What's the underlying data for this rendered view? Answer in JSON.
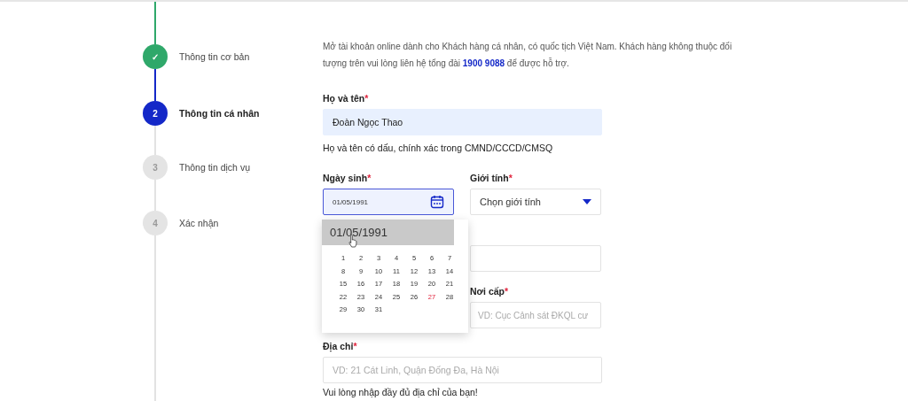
{
  "steps": [
    {
      "marker": "✓",
      "label": "Thông tin cơ bản",
      "kind": "done"
    },
    {
      "marker": "2",
      "label": "Thông tin cá nhân",
      "kind": "current"
    },
    {
      "marker": "3",
      "label": "Thông tin dịch vụ",
      "kind": "pending"
    },
    {
      "marker": "4",
      "label": "Xác nhận",
      "kind": "pending"
    }
  ],
  "intro": "Mở tài khoản online dành cho Khách hàng cá nhân, có quốc tịch Việt Nam. Khách hàng không thuộc đối tượng trên vui lòng liên hệ tổng đài **1900 9088** để được hỗ trợ.",
  "full_name": {
    "label": "Họ và tên",
    "required_mark": "*",
    "value": "Đoàn Ngọc Thao",
    "hint": "Họ và tên có dấu, chính xác trong CMND/CCCD/CMSQ"
  },
  "birth_date": {
    "label": "Ngày sinh",
    "required_mark": "*",
    "value": "01/05/1991",
    "focused": true
  },
  "gender": {
    "label": "Giới tính",
    "required_mark": "*",
    "placeholder": "Chọn giới tính"
  },
  "issue_place": {
    "label": "Nơi cấp",
    "required_mark": "*",
    "placeholder": "VD: Cục Cảnh sát ĐKQL cư"
  },
  "address": {
    "label": "Địa chỉ",
    "required_mark": "*",
    "placeholder": "VD: 21 Cát Linh, Quận Đống Đa, Hà Nội",
    "hint": "Vui lòng nhập đầy đủ địa chỉ của bạn!"
  },
  "autocomplete": {
    "suggestion": "01/05/1991",
    "selected": true
  },
  "calendar_days": [
    {
      "label": "1",
      "today": false
    },
    {
      "label": "2",
      "today": false
    },
    {
      "label": "3",
      "today": false
    },
    {
      "label": "4",
      "today": false
    },
    {
      "label": "5",
      "today": false
    },
    {
      "label": "6",
      "today": false
    },
    {
      "label": "7",
      "today": false
    },
    {
      "label": "8",
      "today": false
    },
    {
      "label": "9",
      "today": false
    },
    {
      "label": "10",
      "today": false
    },
    {
      "label": "11",
      "today": false
    },
    {
      "label": "12",
      "today": false
    },
    {
      "label": "13",
      "today": false
    },
    {
      "label": "14",
      "today": false
    },
    {
      "label": "15",
      "today": false
    },
    {
      "label": "16",
      "today": false
    },
    {
      "label": "17",
      "today": false
    },
    {
      "label": "18",
      "today": false
    },
    {
      "label": "19",
      "today": false
    },
    {
      "label": "20",
      "today": false
    },
    {
      "label": "21",
      "today": false
    },
    {
      "label": "22",
      "today": false
    },
    {
      "label": "23",
      "today": false
    },
    {
      "label": "24",
      "today": false
    },
    {
      "label": "25",
      "today": false
    },
    {
      "label": "26",
      "today": false
    },
    {
      "label": "27",
      "today": true
    },
    {
      "label": "28",
      "today": false
    },
    {
      "label": "29",
      "today": false
    },
    {
      "label": "30",
      "today": false
    },
    {
      "label": "31",
      "today": false
    }
  ]
}
